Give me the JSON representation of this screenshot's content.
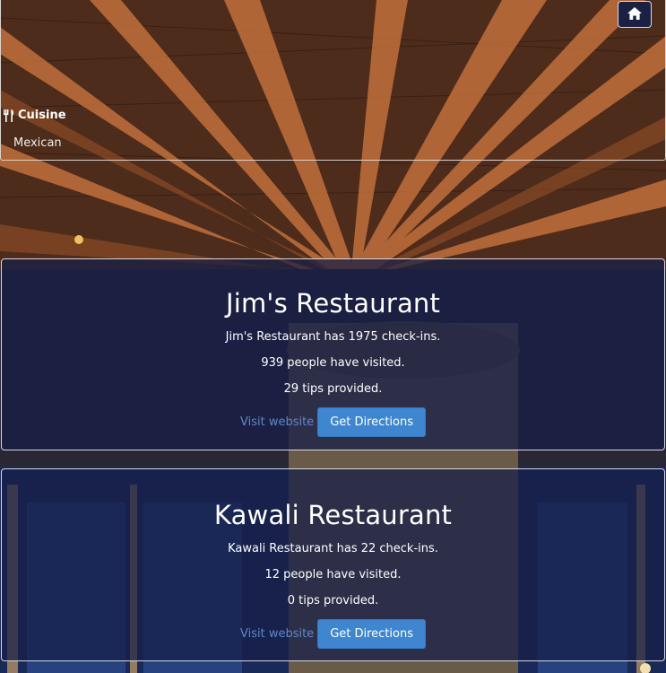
{
  "header": {
    "home_button_icon": "home-icon"
  },
  "cuisine": {
    "icon": "utensils-icon",
    "label": "Cuisine",
    "value": "Mexican"
  },
  "restaurants": [
    {
      "name": "Jim's Restaurant",
      "checkins_text": "Jim's Restaurant has 1975 check-ins.",
      "visited_text": "939 people have visited.",
      "tips_text": "29 tips provided.",
      "website_label": "Visit website",
      "directions_label": "Get Directions"
    },
    {
      "name": "Kawali Restaurant",
      "checkins_text": "Kawali Restaurant has 22 check-ins.",
      "visited_text": "12 people have visited.",
      "tips_text": "0 tips provided.",
      "website_label": "Visit website",
      "directions_label": "Get Directions"
    }
  ],
  "colors": {
    "card_background": "#161e48",
    "link": "#5e87c9",
    "button": "#3f86d0",
    "home_button": "#1a2142"
  }
}
